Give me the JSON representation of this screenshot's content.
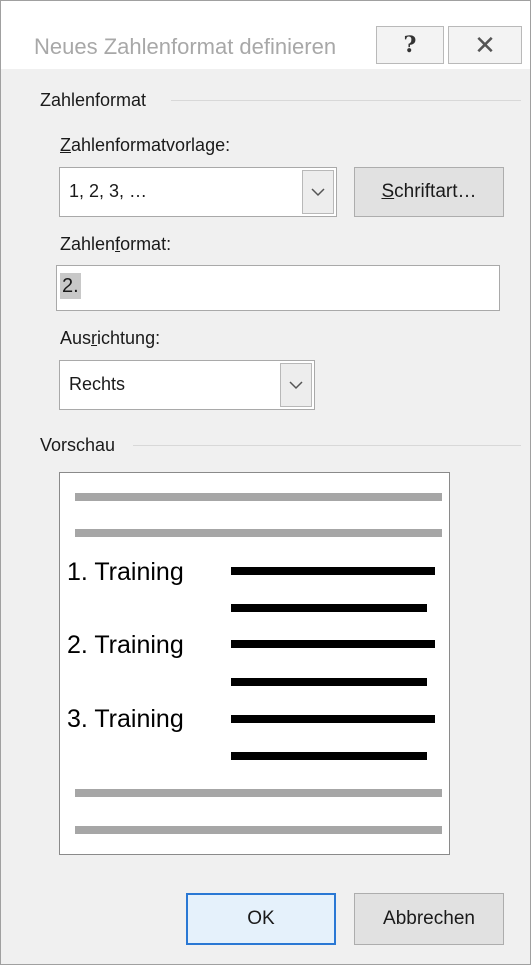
{
  "window": {
    "title": "Neues Zahlenformat definieren",
    "help_label": "?",
    "close_label": "✕"
  },
  "zahlenformat_group": {
    "label": "Zahlenformat",
    "vorlage_label_prefix": "",
    "vorlage_label_accel": "Z",
    "vorlage_label_rest": "ahlenformatvorlage:",
    "vorlage_value": "1, 2, 3, …",
    "schriftart_accel": "S",
    "schriftart_rest": "chriftart…",
    "format_label_prefix": "Zahlen",
    "format_label_accel": "f",
    "format_label_rest": "ormat:",
    "format_value": "2.",
    "ausrichtung_label_prefix": "Aus",
    "ausrichtung_label_accel": "r",
    "ausrichtung_label_rest": "ichtung:",
    "ausrichtung_value": "Rechts"
  },
  "vorschau_group": {
    "label": "Vorschau",
    "entries": [
      "1. Training",
      "2. Training",
      "3. Training"
    ]
  },
  "buttons": {
    "ok": "OK",
    "cancel": "Abbrechen"
  },
  "colors": {
    "dialog_bg": "#f0f0f0",
    "accent": "#2a78d4",
    "preview_gray": "#a6a6a6"
  },
  "icons": {
    "help": "question-mark-icon",
    "close": "close-icon",
    "dropdown": "chevron-down-icon"
  }
}
